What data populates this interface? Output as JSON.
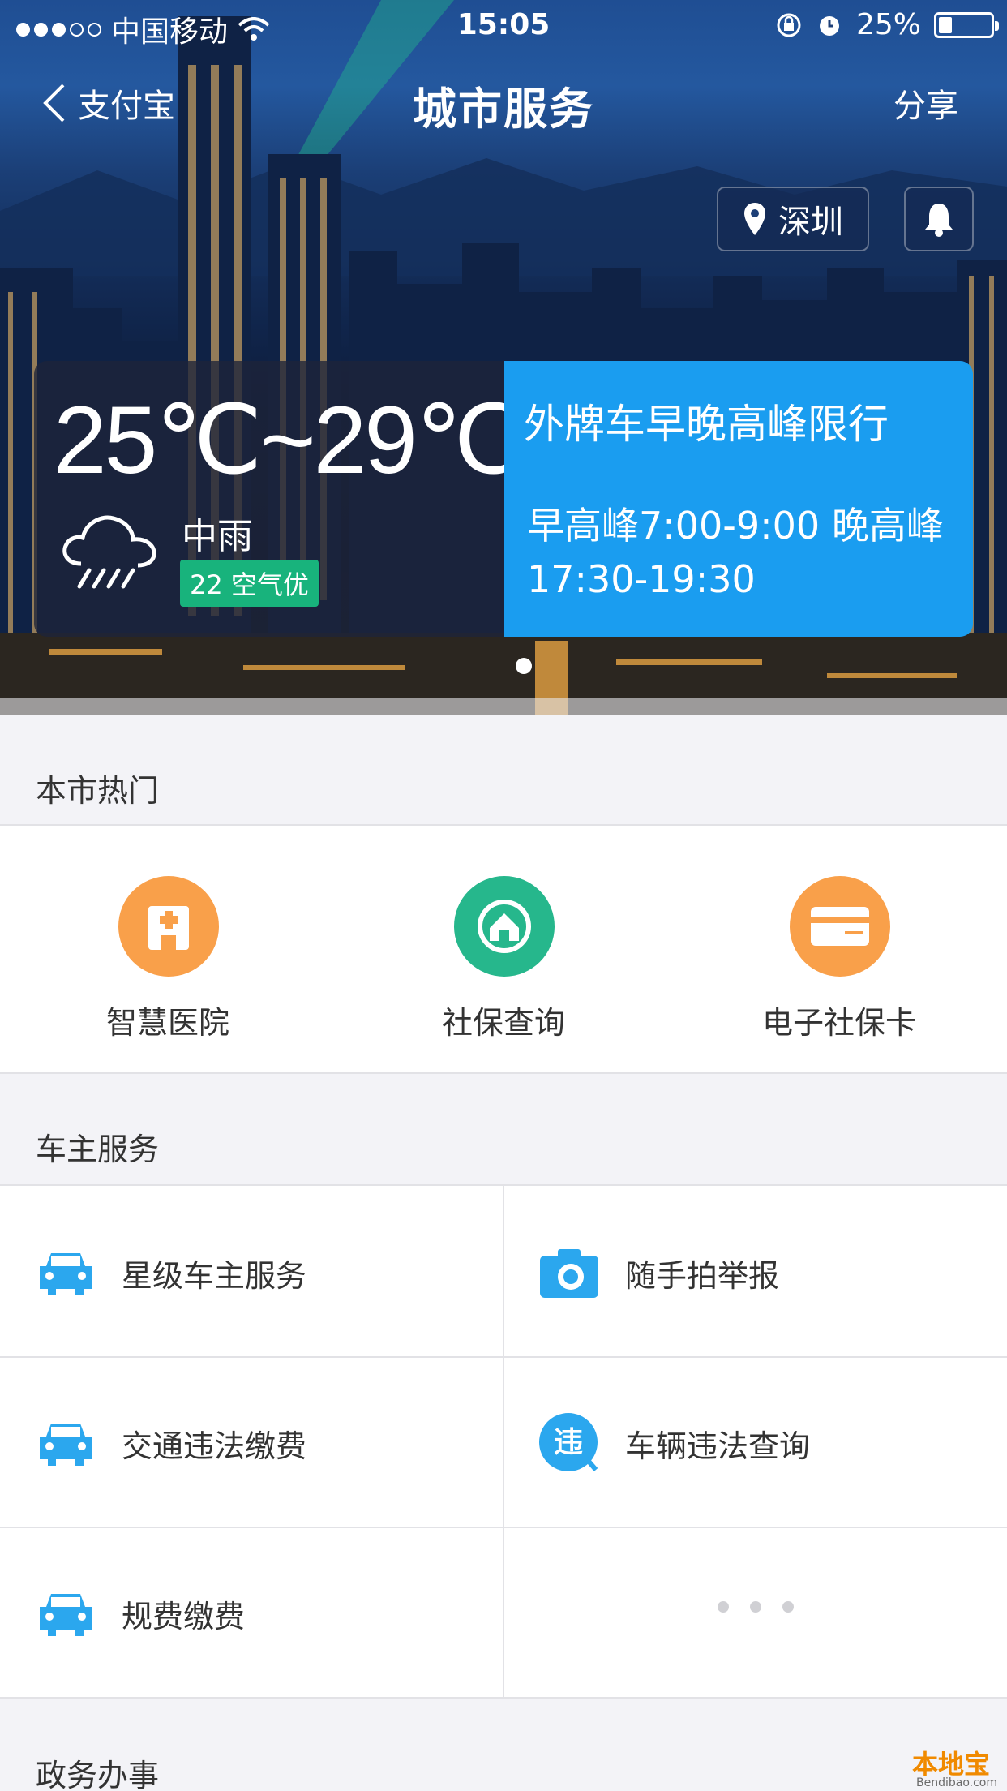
{
  "status_bar": {
    "carrier": "中国移动",
    "time": "15:05",
    "battery": "25%",
    "battery_level": 0.25,
    "signal_bars_filled": 3,
    "signal_bars_total": 5
  },
  "nav": {
    "back_label": "支付宝",
    "title": "城市服务",
    "share_label": "分享"
  },
  "location": {
    "city": "深圳"
  },
  "weather": {
    "temperature": "25℃~29℃",
    "condition": "中雨",
    "aqi": "22 空气优"
  },
  "traffic": {
    "title": "外牌车早晚高峰限行",
    "body": "早高峰7:00-9:00 晚高峰17:30-19:30"
  },
  "hot": {
    "title": "本市热门",
    "items": [
      {
        "label": "智慧医院",
        "icon": "hospital-icon",
        "color": "#f9a04a"
      },
      {
        "label": "社保查询",
        "icon": "social-security-icon",
        "color": "#26b78c"
      },
      {
        "label": "电子社保卡",
        "icon": "card-icon",
        "color": "#f9a04a"
      }
    ]
  },
  "car": {
    "title": "车主服务",
    "items": [
      {
        "label": "星级车主服务",
        "icon": "car-icon"
      },
      {
        "label": "随手拍举报",
        "icon": "camera-icon"
      },
      {
        "label": "交通违法缴费",
        "icon": "car-icon"
      },
      {
        "label": "车辆违法查询",
        "icon": "violation-icon",
        "glyph": "违"
      },
      {
        "label": "规费缴费",
        "icon": "car-icon"
      }
    ],
    "accent": "#2ba7ee"
  },
  "gov": {
    "title": "政务办事"
  },
  "watermark": {
    "brand": "本地宝",
    "domain": "Bendibao.com"
  }
}
